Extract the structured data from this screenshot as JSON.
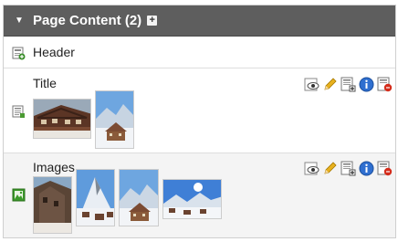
{
  "section": {
    "title": "Page Content (2)"
  },
  "rows": {
    "header": {
      "label": "Header"
    },
    "title": {
      "label": "Title"
    },
    "images": {
      "label": "Images"
    }
  },
  "actions": [
    "preview",
    "edit",
    "insert",
    "info",
    "delete"
  ]
}
